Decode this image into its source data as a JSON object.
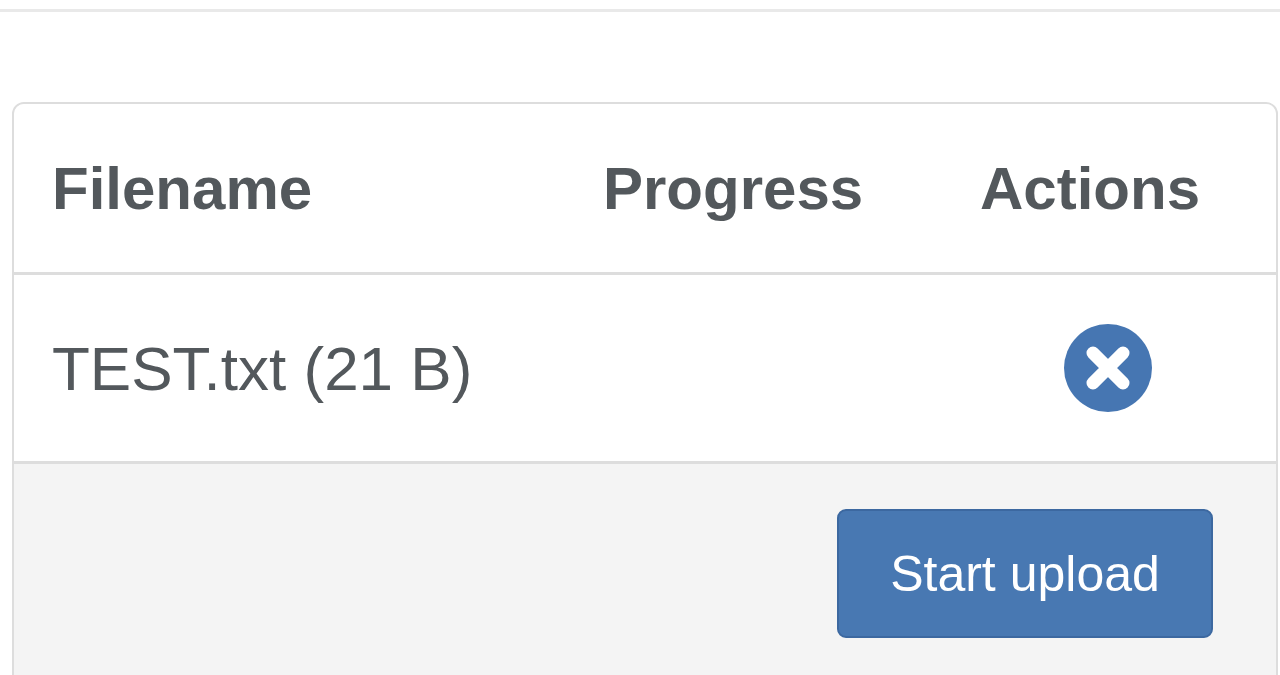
{
  "table": {
    "columns": [
      "Filename",
      "Progress",
      "Actions"
    ],
    "rows": [
      {
        "filename": "TEST.txt (21 B)"
      }
    ]
  },
  "footer": {
    "button": "Start upload"
  }
}
